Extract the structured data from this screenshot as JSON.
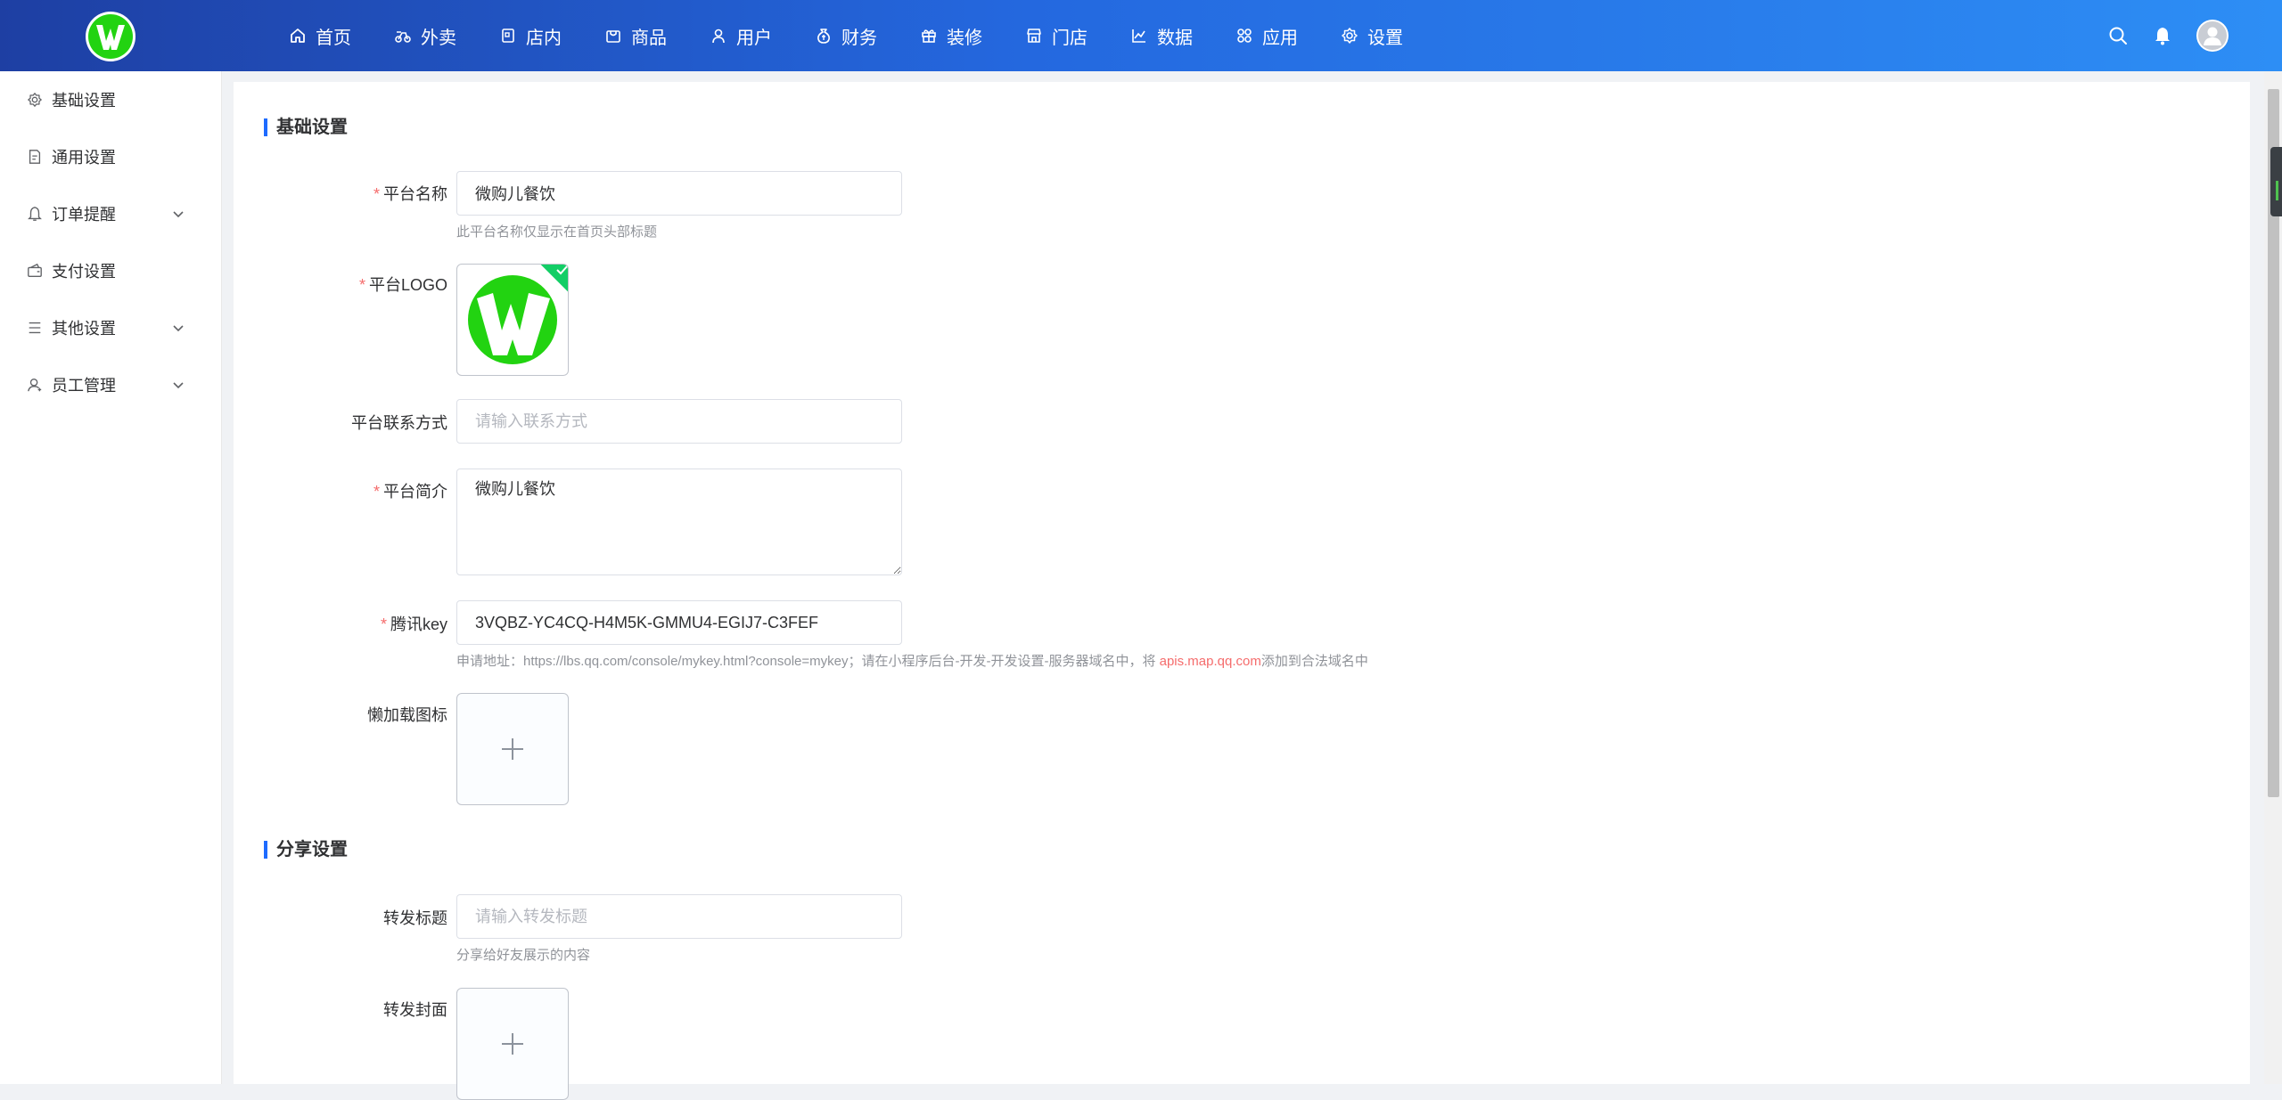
{
  "colors": {
    "topbar_start": "#1e3fa3",
    "topbar_end": "#2d8ef5",
    "accent": "#1e6bff",
    "required": "#f56c6c",
    "logo_green": "#22d311",
    "success": "#13ce66"
  },
  "brand": {
    "logo_letter": "W"
  },
  "nav": [
    {
      "label": "首页",
      "icon": "home-icon"
    },
    {
      "label": "外卖",
      "icon": "bike-icon"
    },
    {
      "label": "店内",
      "icon": "qr-scan-icon"
    },
    {
      "label": "商品",
      "icon": "bag-icon"
    },
    {
      "label": "用户",
      "icon": "user-icon"
    },
    {
      "label": "财务",
      "icon": "money-bag-icon"
    },
    {
      "label": "装修",
      "icon": "gift-icon"
    },
    {
      "label": "门店",
      "icon": "shop-icon"
    },
    {
      "label": "数据",
      "icon": "chart-icon"
    },
    {
      "label": "应用",
      "icon": "grid-icon"
    },
    {
      "label": "设置",
      "icon": "gear-icon"
    }
  ],
  "sidebar": [
    {
      "label": "基础设置",
      "icon": "gear-icon",
      "expandable": false
    },
    {
      "label": "通用设置",
      "icon": "document-icon",
      "expandable": false
    },
    {
      "label": "订单提醒",
      "icon": "bell-icon",
      "expandable": true
    },
    {
      "label": "支付设置",
      "icon": "wallet-icon",
      "expandable": false
    },
    {
      "label": "其他设置",
      "icon": "list-icon",
      "expandable": true
    },
    {
      "label": "员工管理",
      "icon": "person-icon",
      "expandable": true
    }
  ],
  "form": {
    "section_basic": "基础设置",
    "platform_name": {
      "label": "平台名称",
      "value": "微购儿餐饮",
      "help": "此平台名称仅显示在首页头部标题"
    },
    "platform_logo": {
      "label": "平台LOGO"
    },
    "contact": {
      "label": "平台联系方式",
      "placeholder": "请输入联系方式"
    },
    "intro": {
      "label": "平台简介",
      "value": "微购儿餐饮"
    },
    "tencent_key": {
      "label": "腾讯key",
      "value": "3VQBZ-YC4CQ-H4M5K-GMMU4-EGIJ7-C3FEF",
      "help_prefix": "申请地址：https://lbs.qq.com/console/mykey.html?console=mykey；请在小程序后台-开发-开发设置-服务器域名中，将 ",
      "help_domain": "apis.map.qq.com",
      "help_suffix": "添加到合法域名中"
    },
    "lazy_icon": {
      "label": "懒加载图标"
    },
    "section_share": "分享设置",
    "share_title": {
      "label": "转发标题",
      "placeholder": "请输入转发标题",
      "help": "分享给好友展示的内容"
    },
    "share_cover": {
      "label": "转发封面"
    }
  }
}
